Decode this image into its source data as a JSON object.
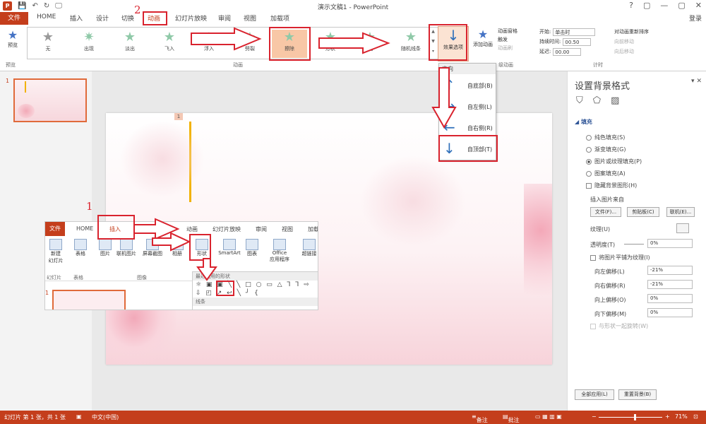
{
  "window": {
    "title": "演示文稿1 - PowerPoint",
    "logo": "P",
    "controls": [
      "?",
      "▢",
      "—",
      "▢",
      "✕"
    ]
  },
  "quick_access": [
    "💾",
    "↶",
    "↻",
    "🖵"
  ],
  "tabs": [
    {
      "label": "文件"
    },
    {
      "label": "HOME"
    },
    {
      "label": "插入"
    },
    {
      "label": "设计"
    },
    {
      "label": "切换"
    },
    {
      "label": "动画"
    },
    {
      "label": "幻灯片放映"
    },
    {
      "label": "审阅"
    },
    {
      "label": "视图"
    },
    {
      "label": "加载项"
    }
  ],
  "login_label": "登录",
  "ribbon": {
    "preview_label": "预览",
    "animations": [
      {
        "label": "无"
      },
      {
        "label": "出现"
      },
      {
        "label": "淡出"
      },
      {
        "label": "飞入"
      },
      {
        "label": "浮入"
      },
      {
        "label": "劈裂"
      },
      {
        "label": "擦除"
      },
      {
        "label": "形状"
      },
      {
        "label": "轮子"
      },
      {
        "label": "随机线条"
      }
    ],
    "effect_options_label": "效果选项",
    "add_animation_label": "添加动画",
    "advanced": {
      "pane_label": "动画窗格",
      "trigger_label": "触发",
      "painter_label": "动画刷"
    },
    "timing": {
      "start_label": "开始:",
      "start_value": "单击时",
      "duration_label": "持续时间:",
      "duration_value": "00.50",
      "delay_label": "延迟:",
      "delay_value": "00.00"
    },
    "reorder": {
      "title": "对动画重新排序",
      "forward": "向前移动",
      "backward": "向后移动"
    },
    "group_labels": {
      "preview": "预览",
      "animation": "动画",
      "advanced": "级动画",
      "timing": "计时"
    }
  },
  "slide_panel": {
    "number": "1"
  },
  "slide": {
    "placeholder_number": "1"
  },
  "direction_menu": {
    "header": "方向",
    "items": [
      {
        "label": "自底部(B)",
        "arrow": "↑"
      },
      {
        "label": "自左侧(L)",
        "arrow": "→"
      },
      {
        "label": "自右侧(R)",
        "arrow": "←"
      },
      {
        "label": "自顶部(T)",
        "arrow": "↓"
      }
    ]
  },
  "inset": {
    "tabs": [
      "文件",
      "HOME",
      "插入",
      "切换",
      "动画",
      "幻灯片放映",
      "审阅",
      "视图",
      "加载"
    ],
    "buttons": [
      {
        "label": "新建\n幻灯片"
      },
      {
        "label": "表格"
      },
      {
        "label": "图片"
      },
      {
        "label": "联机图片"
      },
      {
        "label": "屏幕截图"
      },
      {
        "label": "相册"
      },
      {
        "label": "形状"
      },
      {
        "label": "SmartArt"
      },
      {
        "label": "图表"
      },
      {
        "label": "Office\n应用程序"
      },
      {
        "label": "超链接"
      }
    ],
    "group_labels": {
      "slides": "幻灯片",
      "tables": "表格",
      "images": "图像"
    },
    "shape_menu": {
      "header": "最近使用的形状",
      "row1": "☼ ▣ ▣ ╲ ╲ □ ○ ▭ △ ⅂ ⅂ ⇨",
      "row2": "⇩ ◰ ↗ ↩ ╲ ╯ {",
      "footer": "线条"
    },
    "slide_number": "1"
  },
  "taskpane": {
    "title": "设置背景格式",
    "close": "✕",
    "dropdown": "▾",
    "section": "填充",
    "fill_options": [
      {
        "label": "纯色填充(S)",
        "selected": false
      },
      {
        "label": "渐变填充(G)",
        "selected": false
      },
      {
        "label": "图片或纹理填充(P)",
        "selected": true
      },
      {
        "label": "图案填充(A)",
        "selected": false
      }
    ],
    "hide_bg_label": "隐藏背景图形(H)",
    "insert_from_label": "插入图片来自",
    "buttons": {
      "file": "文件(F)...",
      "clipboard": "剪贴板(C)",
      "online": "联机(E)..."
    },
    "texture_label": "纹理(U)",
    "transparency_label": "透明度(T)",
    "transparency_value": "0%",
    "tile_label": "将图片平铺为纹理(I)",
    "offsets": [
      {
        "label": "向左偏移(L)",
        "value": "-21%"
      },
      {
        "label": "向右偏移(R)",
        "value": "-21%"
      },
      {
        "label": "向上偏移(O)",
        "value": "0%"
      },
      {
        "label": "向下偏移(M)",
        "value": "0%"
      }
    ],
    "rotate_label": "与形状一起旋转(W)",
    "apply_all": "全部应用(L)",
    "reset_bg": "重置背景(B)"
  },
  "status": {
    "slide_info": "幻灯片 第 1 张，共 1 张",
    "language": "中文(中国)",
    "notes": "备注",
    "comments": "批注",
    "zoom": "71%"
  },
  "annotations": {
    "step1": "1",
    "step2": "2"
  },
  "colors": {
    "accent": "#c43e1c",
    "highlight_red": "#d9232e",
    "arrow_blue": "#2f6fba"
  }
}
